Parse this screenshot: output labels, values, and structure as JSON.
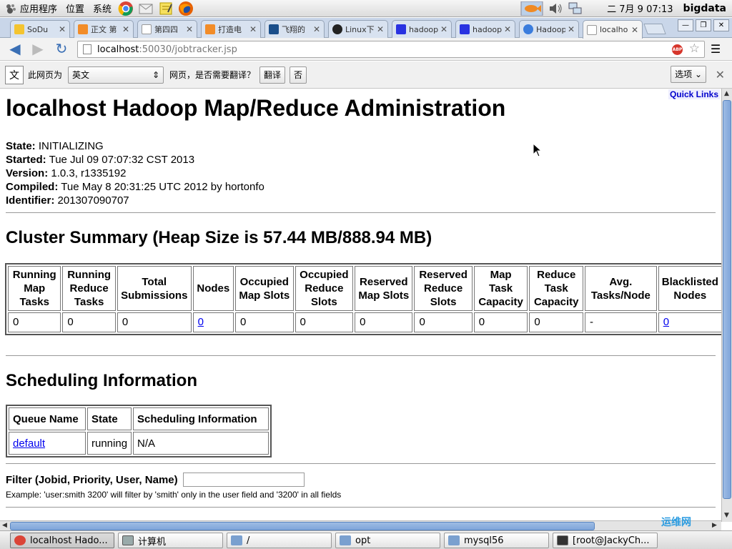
{
  "gnome_panel": {
    "menus": [
      "应用程序",
      "位置",
      "系统"
    ],
    "launchers": [
      "chrome-icon",
      "mail-icon",
      "notes-icon",
      "firefox-icon"
    ],
    "clock": "二 7月  9 07:13",
    "user": "bigdata"
  },
  "tabs": [
    {
      "title": "SoDu",
      "icon": "sodu-icon"
    },
    {
      "title": "正文 第",
      "icon": "novel-icon"
    },
    {
      "title": "第四四",
      "icon": "page-icon"
    },
    {
      "title": "打造电",
      "icon": "novel-icon"
    },
    {
      "title": "飞翔的",
      "icon": "site-icon"
    },
    {
      "title": "Linux下",
      "icon": "tux-icon"
    },
    {
      "title": "hadoop",
      "icon": "baidu-icon"
    },
    {
      "title": "hadoop",
      "icon": "baidu-icon"
    },
    {
      "title": "Hadoop",
      "icon": "chrome-site-icon"
    },
    {
      "title": "localho",
      "icon": "page-icon"
    }
  ],
  "address": {
    "host": "localhost",
    "path": ":50030/jobtracker.jsp"
  },
  "translate": {
    "this_page_is": "此网页为",
    "language": "英文",
    "question": "网页，是否需要翻译？",
    "translate_btn": "翻译",
    "no_btn": "否",
    "options_btn": "选项"
  },
  "page": {
    "quick_links": "Quick Links",
    "title": "localhost Hadoop Map/Reduce Administration",
    "info": [
      {
        "label": "State:",
        "value": "INITIALIZING"
      },
      {
        "label": "Started:",
        "value": "Tue Jul 09 07:07:32 CST 2013"
      },
      {
        "label": "Version:",
        "value": "1.0.3, r1335192"
      },
      {
        "label": "Compiled:",
        "value": "Tue May 8 20:31:25 UTC 2012 by hortonfo"
      },
      {
        "label": "Identifier:",
        "value": "201307090707"
      }
    ],
    "cluster_heading": "Cluster Summary (Heap Size is 57.44 MB/888.94 MB)",
    "cluster_headers": [
      "Running Map Tasks",
      "Running Reduce Tasks",
      "Total Submissions",
      "Nodes",
      "Occupied Map Slots",
      "Occupied Reduce Slots",
      "Reserved Map Slots",
      "Reserved Reduce Slots",
      "Map Task Capacity",
      "Reduce Task Capacity",
      "Avg. Tasks/Node",
      "Blacklisted Nodes"
    ],
    "cluster_values": [
      "0",
      "0",
      "0",
      "0",
      "0",
      "0",
      "0",
      "0",
      "0",
      "0",
      "-",
      "0"
    ],
    "scheduling_heading": "Scheduling Information",
    "queue_headers": [
      "Queue Name",
      "State",
      "Scheduling Information"
    ],
    "queue_row": {
      "name": "default",
      "state": "running",
      "info": "N/A"
    },
    "filter_label": "Filter (Jobid, Priority, User, Name)",
    "filter_value": "",
    "example": "Example: 'user:smith 3200' will filter by 'smith' only in the user field and '3200' in all fields"
  },
  "taskbar": [
    {
      "label": "localhost Hado...",
      "icon": "chrome-icon"
    },
    {
      "label": "计算机",
      "icon": "computer-icon"
    },
    {
      "label": "/",
      "icon": "folder-icon"
    },
    {
      "label": "opt",
      "icon": "folder-icon"
    },
    {
      "label": "mysql56",
      "icon": "folder-icon"
    },
    {
      "label": "[root@JackyCh...",
      "icon": "terminal-icon"
    }
  ],
  "watermark": "运维网"
}
